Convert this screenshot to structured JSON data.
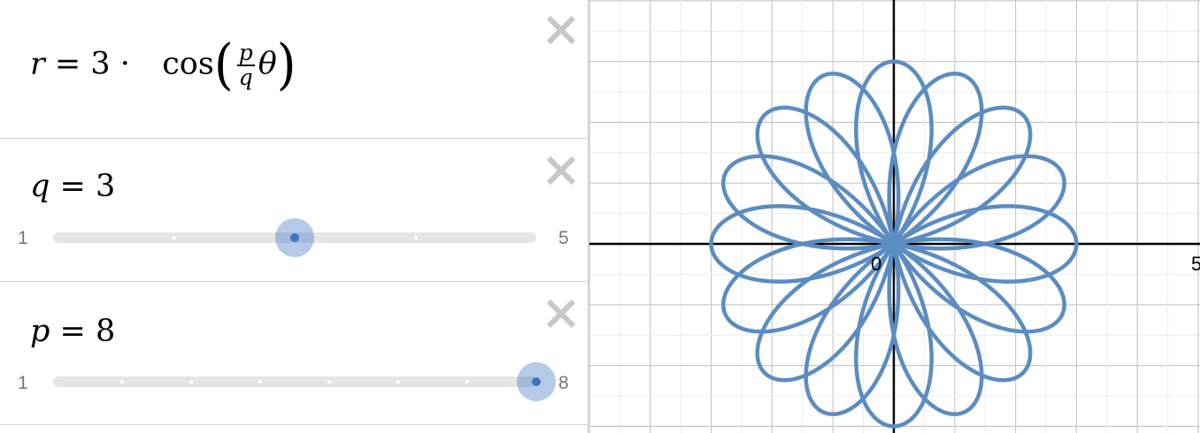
{
  "expressions": [
    {
      "type": "equation",
      "lhs": "r",
      "eq": "=",
      "coef": "3",
      "dot": "·",
      "func": "cos",
      "frac_num": "p",
      "frac_den": "q",
      "var": "θ"
    },
    {
      "type": "slider",
      "name": "q",
      "eq": "=",
      "value_text": "3",
      "min": "1",
      "max": "5",
      "value": 3
    },
    {
      "type": "slider",
      "name": "p",
      "eq": "=",
      "value_text": "8",
      "min": "1",
      "max": "8",
      "value": 8
    }
  ],
  "graph": {
    "origin_label": "0",
    "x_label_right": "5",
    "curve_color": "#5b8cc2",
    "amplitude": 3,
    "grid": true
  }
}
